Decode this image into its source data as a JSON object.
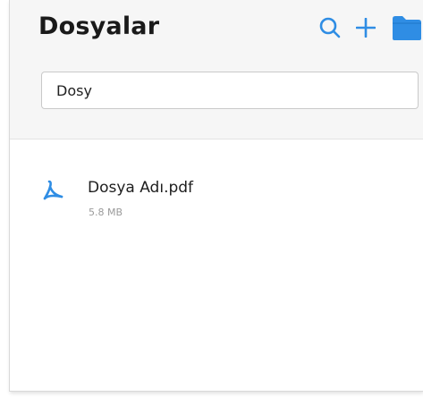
{
  "header": {
    "title": "Dosyalar"
  },
  "toolbar": {
    "search_icon": "search-icon",
    "add_icon": "plus-icon",
    "folder_icon": "folder-icon",
    "accent_color": "#2f8de4"
  },
  "search": {
    "value": "Dosy",
    "placeholder": ""
  },
  "files": [
    {
      "name": "Dosya Adı.pdf",
      "size": "5.8 MB",
      "icon": "pdf-icon"
    }
  ]
}
